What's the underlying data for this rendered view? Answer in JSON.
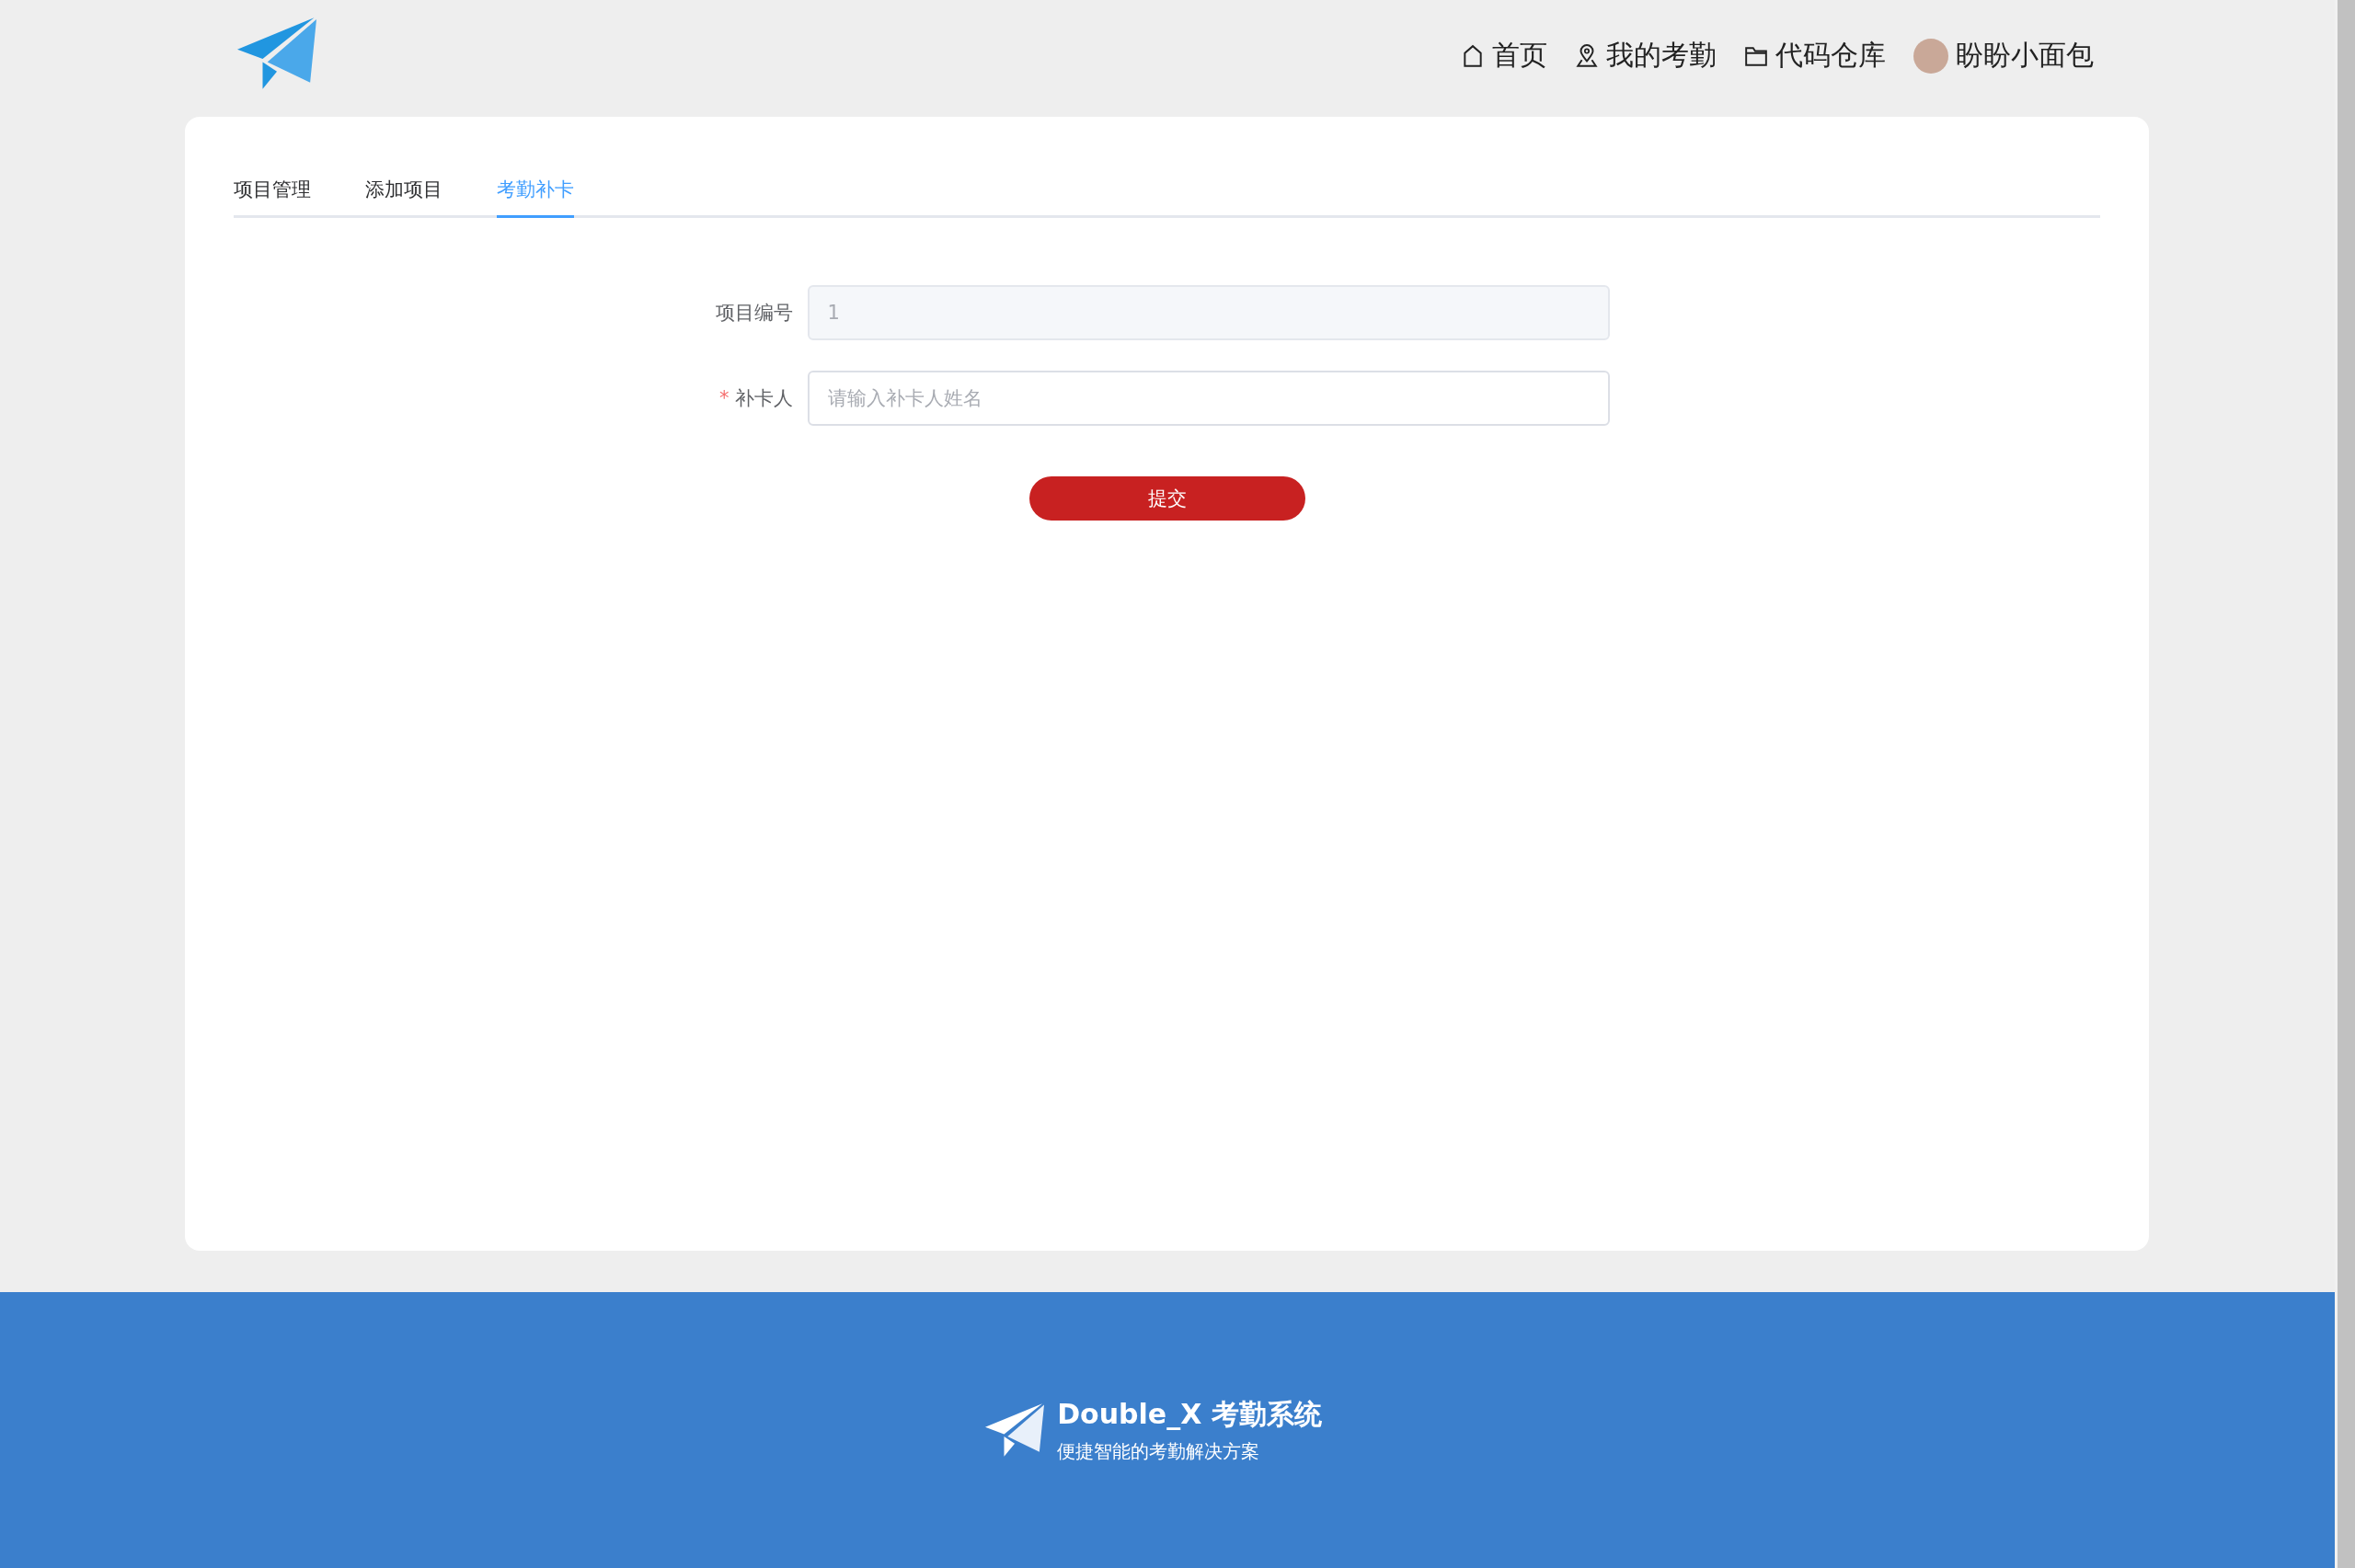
{
  "nav": [
    {
      "kind": "home",
      "label": "首页"
    },
    {
      "kind": "location",
      "label": "我的考勤"
    },
    {
      "kind": "folder",
      "label": "代码仓库"
    },
    {
      "kind": "user",
      "label": "盼盼小面包"
    }
  ],
  "tabs": [
    {
      "label": "项目管理",
      "selected": false
    },
    {
      "label": "添加项目",
      "selected": false
    },
    {
      "label": "考勤补卡",
      "selected": true
    }
  ],
  "form": {
    "fields": [
      {
        "label": "项目编号",
        "disabled": true,
        "value": "1"
      },
      {
        "label": "补卡人",
        "required_mark": "*",
        "disabled": false,
        "placeholder": "请输入补卡人姓名"
      }
    ],
    "submit": "提交"
  },
  "footer": {
    "title": "Double_X 考勤系统",
    "subtitle": "便捷智能的考勤解决方案"
  }
}
